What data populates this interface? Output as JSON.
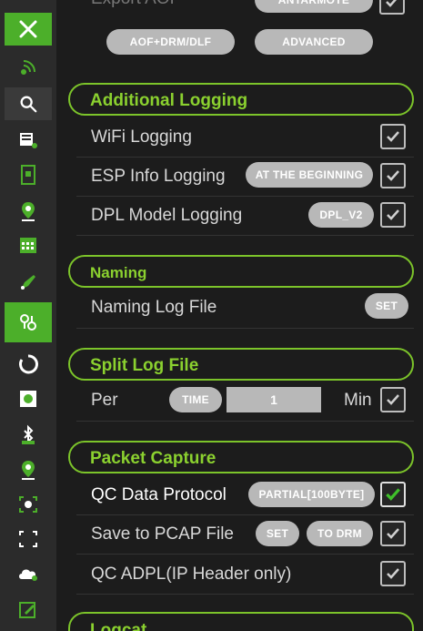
{
  "sidebar": {
    "items": [
      {
        "icon": "tools-icon"
      },
      {
        "icon": "signal-icon"
      },
      {
        "icon": "search-icon"
      },
      {
        "icon": "network-stats-icon"
      },
      {
        "icon": "document-icon"
      },
      {
        "icon": "map-pin-icon"
      },
      {
        "icon": "calendar-icon"
      },
      {
        "icon": "edit-tag-icon"
      },
      {
        "icon": "hand-settings-icon"
      },
      {
        "icon": "circle-loading-icon"
      },
      {
        "icon": "record-icon"
      },
      {
        "icon": "bluetooth-icon"
      },
      {
        "icon": "location-icon"
      },
      {
        "icon": "camera-icon"
      },
      {
        "icon": "expand-icon"
      },
      {
        "icon": "cloud-icon"
      },
      {
        "icon": "note-edit-icon"
      }
    ],
    "accent_color": "#4caf2a"
  },
  "top": {
    "partial_label": "Export AOF",
    "partial_button": "ANTARMOTE",
    "aof_button": "AOF+DRM/DLF",
    "advanced_button": "ADVANCED"
  },
  "additional_logging": {
    "title": "Additional Logging",
    "wifi_label": "WiFi Logging",
    "esp_label": "ESP Info Logging",
    "esp_button": "AT THE BEGINNING",
    "dpl_label": "DPL Model Logging",
    "dpl_button": "DPL_V2"
  },
  "naming": {
    "title": "Naming",
    "label": "Naming Log File",
    "button": "SET"
  },
  "split": {
    "title": "Split Log File",
    "per_label": "Per",
    "time_button": "TIME",
    "value": "1",
    "unit": "Min"
  },
  "packet_capture": {
    "title": "Packet Capture",
    "qc_label": "QC Data Protocol",
    "qc_button": "PARTIAL[100BYTE]",
    "pcap_label": "Save to PCAP File",
    "pcap_set": "SET",
    "pcap_drm": "TO DRM",
    "adpl_label": "QC ADPL(IP Header only)"
  },
  "logcat": {
    "title": "Logcat"
  },
  "colors": {
    "section_title": "#8bd12f",
    "section_border": "#7cc42a",
    "active_check": "#3fbf2a"
  }
}
